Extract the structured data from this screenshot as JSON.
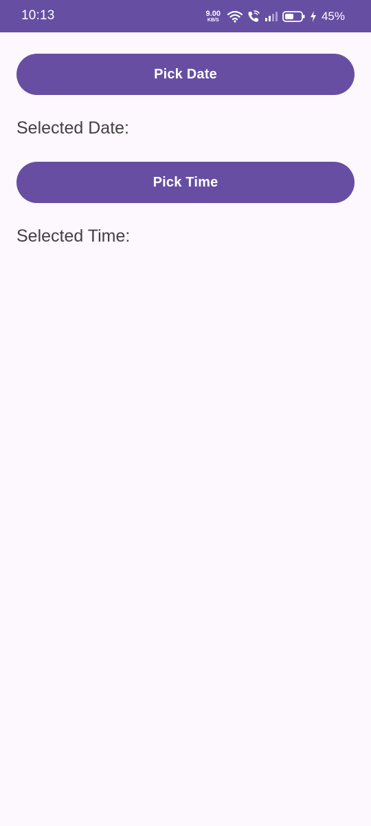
{
  "status_bar": {
    "time": "10:13",
    "net_speed_value": "9.00",
    "net_speed_unit": "KB/S",
    "battery_percent": "45%",
    "icons": [
      "wifi-icon",
      "wifi-call-icon",
      "signal-icon",
      "battery-icon",
      "charging-bolt-icon"
    ],
    "background_color": "#664fa2"
  },
  "main": {
    "pick_date_label": "Pick Date",
    "selected_date_label": "Selected Date:",
    "pick_time_label": "Pick Time",
    "selected_time_label": "Selected Time:",
    "button_color": "#674ea3",
    "background_color": "#fdf7fe"
  }
}
